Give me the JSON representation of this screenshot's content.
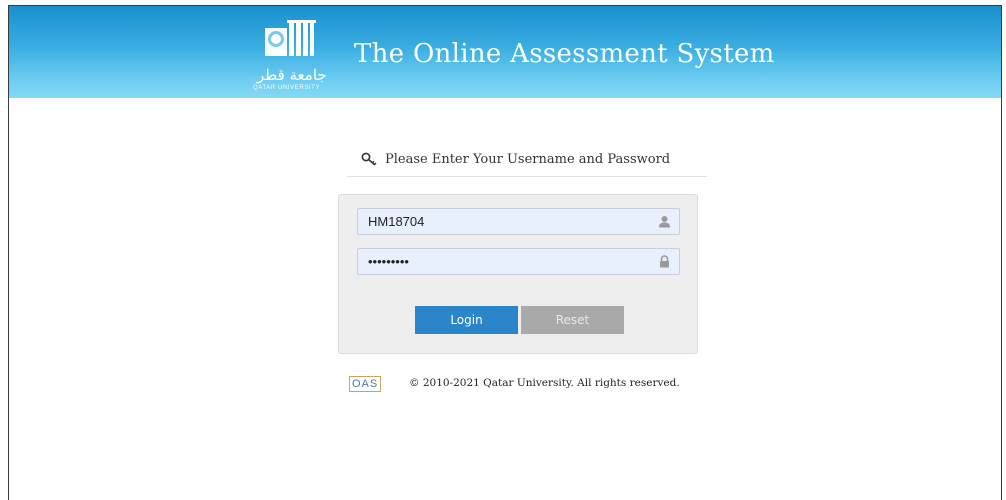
{
  "header": {
    "title": "The Online Assessment System",
    "logo_arabic": "جامعة قطر",
    "logo_english": "QATAR UNIVERSITY",
    "gradient_top": "#1a8fcf",
    "gradient_bottom": "#86d8f6"
  },
  "login": {
    "heading": "Please Enter Your Username and Password",
    "username_value": "HM18704",
    "password_value": "secret123",
    "login_label": "Login",
    "reset_label": "Reset",
    "login_color": "#2a86c8",
    "reset_color": "#a9a9a9",
    "icons": {
      "heading": "key-icon",
      "username": "user-icon",
      "password": "lock-icon"
    }
  },
  "footer": {
    "oas_logo": "OAS",
    "copyright": "© 2010-2021 Qatar University. All rights reserved."
  }
}
